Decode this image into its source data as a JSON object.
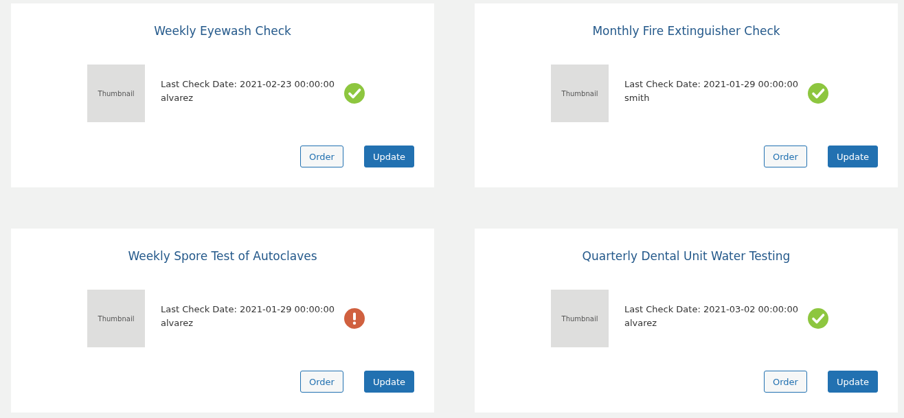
{
  "cards": [
    {
      "title": "Weekly Eyewash Check",
      "thumbnail": "Thumbnail",
      "last_check": "Last Check Date: 2021-02-23 00:00:00",
      "user": "alvarez",
      "passed": true,
      "buttons": [
        "Order",
        "Update"
      ]
    },
    {
      "title": "Monthly Fire Extinguisher Check",
      "thumbnail": "Thumbnail",
      "last_check": "Last Check Date: 2021-01-29 00:00:00",
      "user": "smith",
      "passed": true,
      "buttons": [
        "Order",
        "Update"
      ]
    },
    {
      "title": "Weekly Spore Test of Autoclaves",
      "thumbnail": "Thumbnail",
      "last_check": "Last Check Date: 2021-01-29 00:00:00",
      "user": "alvarez",
      "passed": false,
      "buttons": [
        "Order",
        "Update"
      ]
    },
    {
      "title": "Quarterly Dental Unit Water Testing",
      "thumbnail": "Thumbnail",
      "last_check": "Last Check Date: 2021-03-02 00:00:00",
      "user": "alvarez",
      "passed": true,
      "buttons": [
        "Order",
        "Update"
      ]
    }
  ]
}
